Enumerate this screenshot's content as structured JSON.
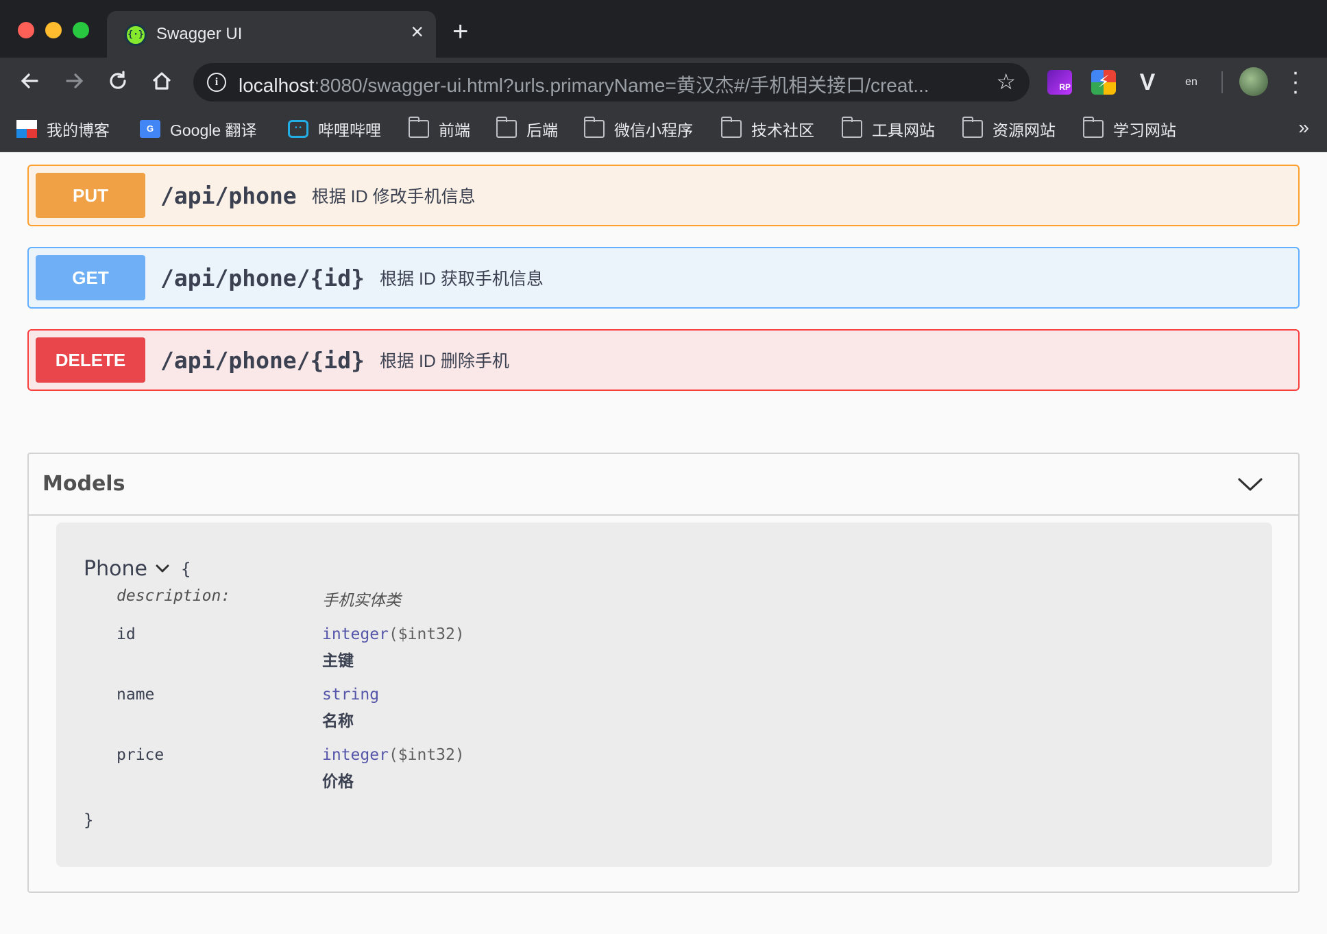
{
  "browser": {
    "tab_title": "Swagger UI",
    "url_host": "localhost",
    "url_rest": ":8080/swagger-ui.html?urls.primaryName=黄汉杰#/手机相关接口/creat...",
    "bookmarks": [
      {
        "label": "我的博客",
        "icon": "blog-icon"
      },
      {
        "label": "Google 翻译",
        "icon": "google-translate-icon"
      },
      {
        "label": "哔哩哔哩",
        "icon": "bilibili-icon"
      },
      {
        "label": "前端",
        "icon": "folder-icon"
      },
      {
        "label": "后端",
        "icon": "folder-icon"
      },
      {
        "label": "微信小程序",
        "icon": "folder-icon"
      },
      {
        "label": "技术社区",
        "icon": "folder-icon"
      },
      {
        "label": "工具网站",
        "icon": "folder-icon"
      },
      {
        "label": "资源网站",
        "icon": "folder-icon"
      },
      {
        "label": "学习网站",
        "icon": "folder-icon"
      }
    ],
    "extensions": [
      {
        "name": "axure-rp-extension-icon",
        "text": "RP"
      },
      {
        "name": "lightning-extension-icon",
        "text": "⚡"
      },
      {
        "name": "vue-devtools-icon",
        "text": "V"
      },
      {
        "name": "translate-extension-icon",
        "text": "en"
      }
    ]
  },
  "operations": [
    {
      "method": "PUT",
      "path": "/api/phone",
      "summary": "根据 ID 修改手机信息",
      "color": "#fca130"
    },
    {
      "method": "GET",
      "path": "/api/phone/{id}",
      "summary": "根据 ID 获取手机信息",
      "color": "#61affe"
    },
    {
      "method": "DELETE",
      "path": "/api/phone/{id}",
      "summary": "根据 ID 删除手机",
      "color": "#f93e3e"
    }
  ],
  "models": {
    "title": "Models",
    "model": {
      "name": "Phone",
      "brace_open": "{",
      "brace_close": "}",
      "description_key": "description:",
      "description_value": "手机实体类",
      "properties": [
        {
          "key": "id",
          "type": "integer",
          "format": "($int32)",
          "note": "主键"
        },
        {
          "key": "name",
          "type": "string",
          "format": "",
          "note": "名称"
        },
        {
          "key": "price",
          "type": "integer",
          "format": "($int32)",
          "note": "价格"
        }
      ]
    }
  }
}
